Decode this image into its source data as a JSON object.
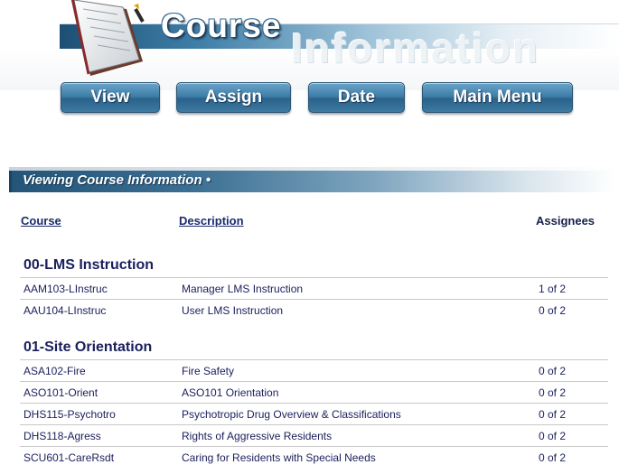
{
  "header": {
    "title_main": "Course",
    "title_secondary": "Information"
  },
  "nav": {
    "view": "View",
    "assign": "Assign",
    "date": "Date",
    "main_menu": "Main Menu"
  },
  "section": {
    "title": "Viewing Course Information •"
  },
  "table": {
    "columns": {
      "course": "Course",
      "description": "Description",
      "assignees": "Assignees"
    },
    "groups": [
      {
        "name": "00-LMS Instruction",
        "rows": [
          {
            "course": "AAM103-LInstruc",
            "description": "Manager LMS Instruction",
            "assignees": "1 of 2"
          },
          {
            "course": "AAU104-LInstruc",
            "description": "User LMS Instruction",
            "assignees": "0 of 2"
          }
        ]
      },
      {
        "name": "01-Site Orientation",
        "rows": [
          {
            "course": "ASA102-Fire",
            "description": "Fire Safety",
            "assignees": "0 of 2"
          },
          {
            "course": "ASO101-Orient",
            "description": "ASO101 Orientation",
            "assignees": "0 of 2"
          },
          {
            "course": "DHS115-Psychotro",
            "description": "Psychotropic Drug Overview & Classifications",
            "assignees": "0 of 2"
          },
          {
            "course": "DHS118-Agress",
            "description": "Rights of Aggressive Residents",
            "assignees": "0 of 2"
          },
          {
            "course": "SCU601-CareRsdt",
            "description": "Caring for Residents with Special Needs",
            "assignees": "0 of 2"
          }
        ]
      }
    ]
  }
}
